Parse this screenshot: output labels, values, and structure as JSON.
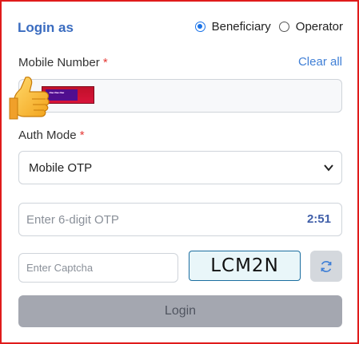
{
  "header": {
    "title": "Login as",
    "roles": [
      {
        "label": "Beneficiary",
        "selected": true
      },
      {
        "label": "Operator",
        "selected": false
      }
    ]
  },
  "mobile": {
    "label": "Mobile Number",
    "required_mark": "*",
    "clear_all": "Clear all"
  },
  "auth": {
    "label": "Auth Mode",
    "required_mark": "*",
    "selected": "Mobile OTP"
  },
  "otp": {
    "placeholder": "Enter 6-digit OTP",
    "timer": "2:51"
  },
  "captcha": {
    "placeholder": "Enter Captcha",
    "code": "LCM2N"
  },
  "login": {
    "label": "Login"
  },
  "colors": {
    "accent": "#3a6cc0",
    "border_frame": "#e01b1b",
    "login_disabled": "#a4a7b0"
  },
  "icons": {
    "thumb": "thumbs-up-icon",
    "refresh": "refresh-icon",
    "chevron": "chevron-down-icon"
  }
}
